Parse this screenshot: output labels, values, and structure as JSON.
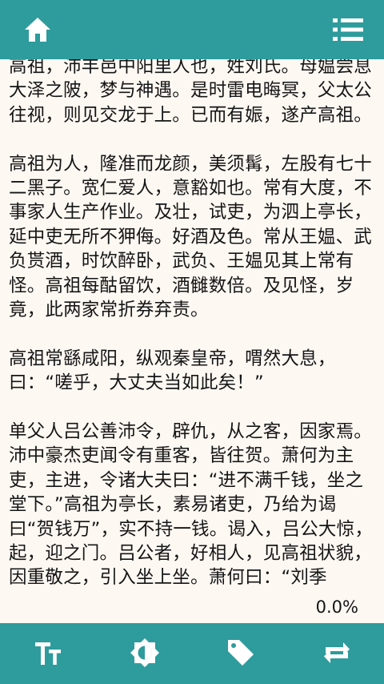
{
  "toolbar": {
    "home_icon": "home-icon",
    "menu_icon": "list-menu-icon",
    "color": "#2e9b9c"
  },
  "reader": {
    "paragraphs": [
      "高祖，沛丰邑中阳里人也，姓刘氏。母媪尝息大泽之陂，梦与神遇。是时雷电晦冥，父太公往视，则见交龙于上。已而有娠，遂产高祖。",
      "高祖为人，隆准而龙颜，美须髯，左股有七十二黑子。宽仁爱人，意豁如也。常有大度，不事家人生产作业。及壮，试吏，为泗上亭长，延中吏无所不狎侮。好酒及色。常从王媪、武负贳酒，时饮醉卧，武负、王媪见其上常有怪。高祖每酤留饮，酒雠数倍。及见怪，岁竟，此两家常折券弃责。",
      "高祖常繇咸阳，纵观秦皇帝，喟然大息，曰：“嗟乎，大丈夫当如此矣！”",
      "单父人吕公善沛令，辟仇，从之客，因家焉。沛中豪杰吏闻令有重客，皆往贺。萧何为主吏，主进，令诸大夫曰：“进不满千钱，坐之堂下。”高祖为亭长，素易诸吏，乃给为谒曰“贺钱万”，实不持一钱。谒入，吕公大惊，起，迎之门。吕公者，好相人，见高祖状貌，因重敬之，引入坐上坐。萧何曰：“刘季"
    ],
    "progress": "0.0%"
  },
  "bottom_tools": [
    {
      "icon": "font-size-icon"
    },
    {
      "icon": "brightness-icon"
    },
    {
      "icon": "bookmark-tag-icon"
    },
    {
      "icon": "switch-arrows-icon"
    }
  ]
}
